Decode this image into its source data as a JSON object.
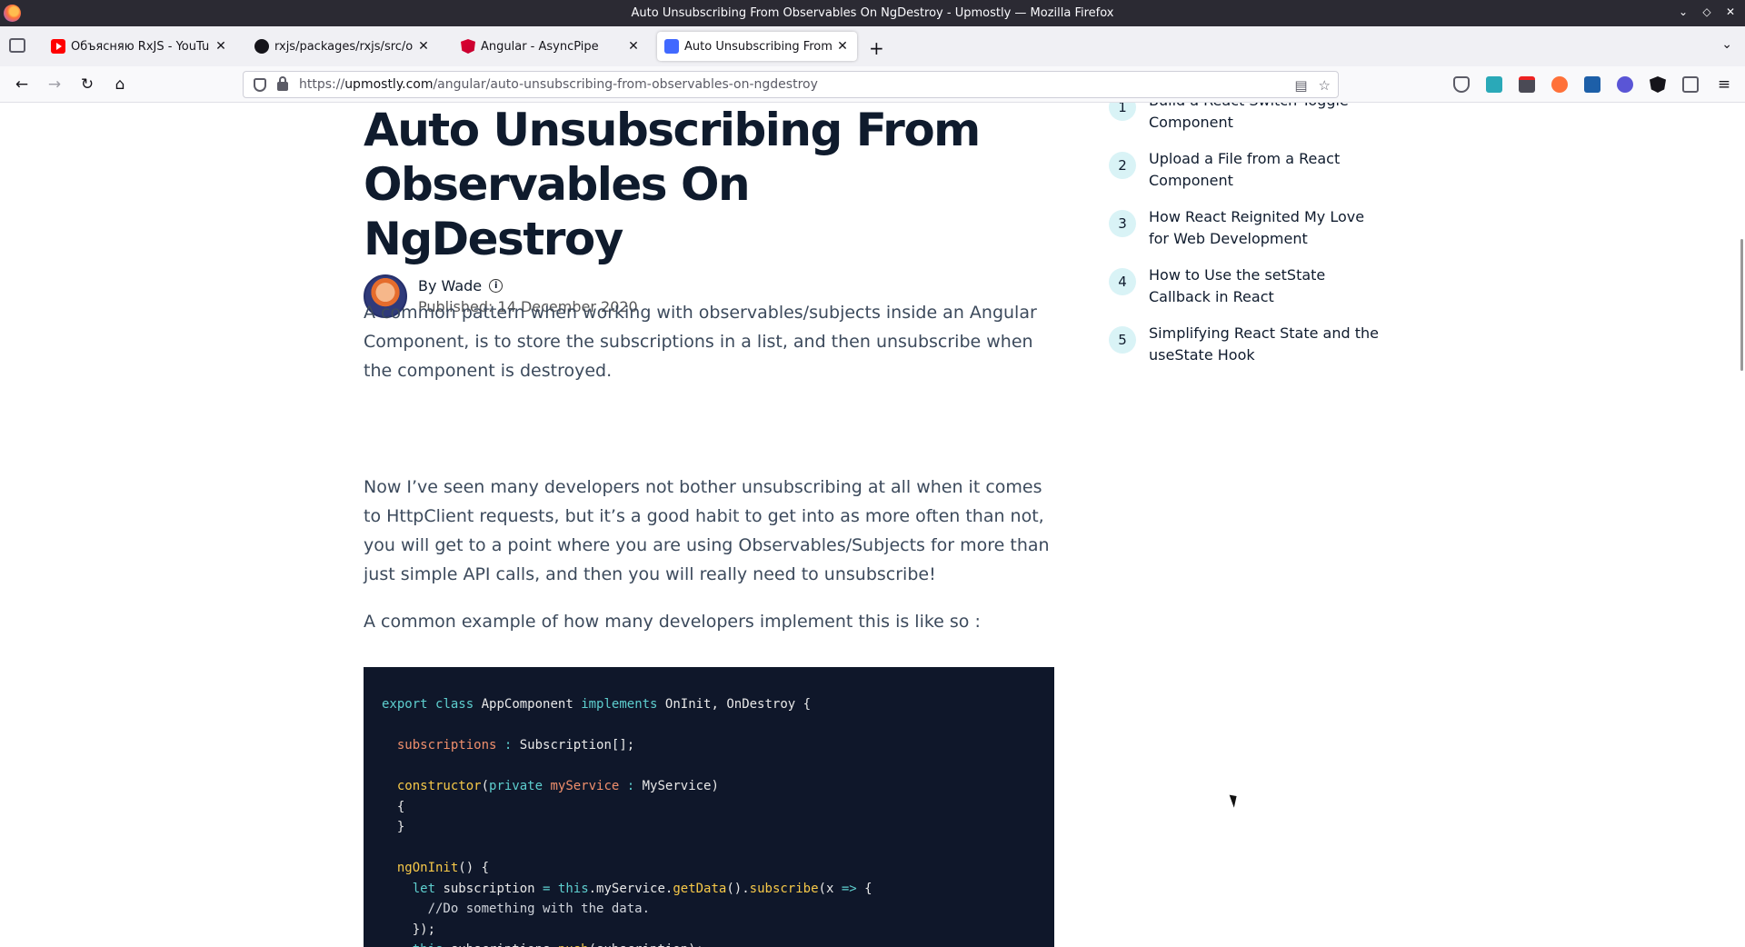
{
  "window": {
    "title": "Auto Unsubscribing From Observables On NgDestroy - Upmostly — Mozilla Firefox"
  },
  "tabs": [
    {
      "title": "Объясняю RxJS - YouTube",
      "icon": "youtube-icon"
    },
    {
      "title": "rxjs/packages/rxjs/src/ope",
      "icon": "github-icon"
    },
    {
      "title": "Angular - AsyncPipe",
      "icon": "angular-icon"
    },
    {
      "title": "Auto Unsubscribing From O",
      "icon": "upmostly-icon",
      "active": true
    }
  ],
  "urlbar": {
    "prefix": "https://",
    "host": "upmostly.com",
    "path": "/angular/auto-unsubscribing-from-observables-on-ngdestroy"
  },
  "article": {
    "title": "Auto Unsubscribing From Observables On NgDestroy",
    "author_prefix": "By",
    "author": "Wade",
    "published": "Published: 14 December 2020",
    "paragraphs": [
      "A common pattern when working with observables/subjects inside an Angular Component, is to store the subscriptions in a list, and then unsubscribe when the component is destroyed.",
      "Now I’ve seen many developers not bother unsubscribing at all when it comes to HttpClient requests, but it’s a good habit to get into as more often than not, you will get to a point where you are using Observables/Subjects for more than just simple API calls, and then you will really need to unsubscribe!",
      "A common example of how many developers implement this is like so :"
    ]
  },
  "sidebar": {
    "items": [
      {
        "num": "1",
        "label": "Build a React Switch Toggle Component"
      },
      {
        "num": "2",
        "label": "Upload a File from a React Component"
      },
      {
        "num": "3",
        "label": "How React Reignited My Love for Web Development"
      },
      {
        "num": "4",
        "label": "How to Use the setState Callback in React"
      },
      {
        "num": "5",
        "label": "Simplifying React State and the useState Hook"
      }
    ]
  },
  "colors": {
    "code_bg": "#0f172a",
    "accent_badge": "#d9f3f6",
    "title_text": "#0f1b2d"
  }
}
